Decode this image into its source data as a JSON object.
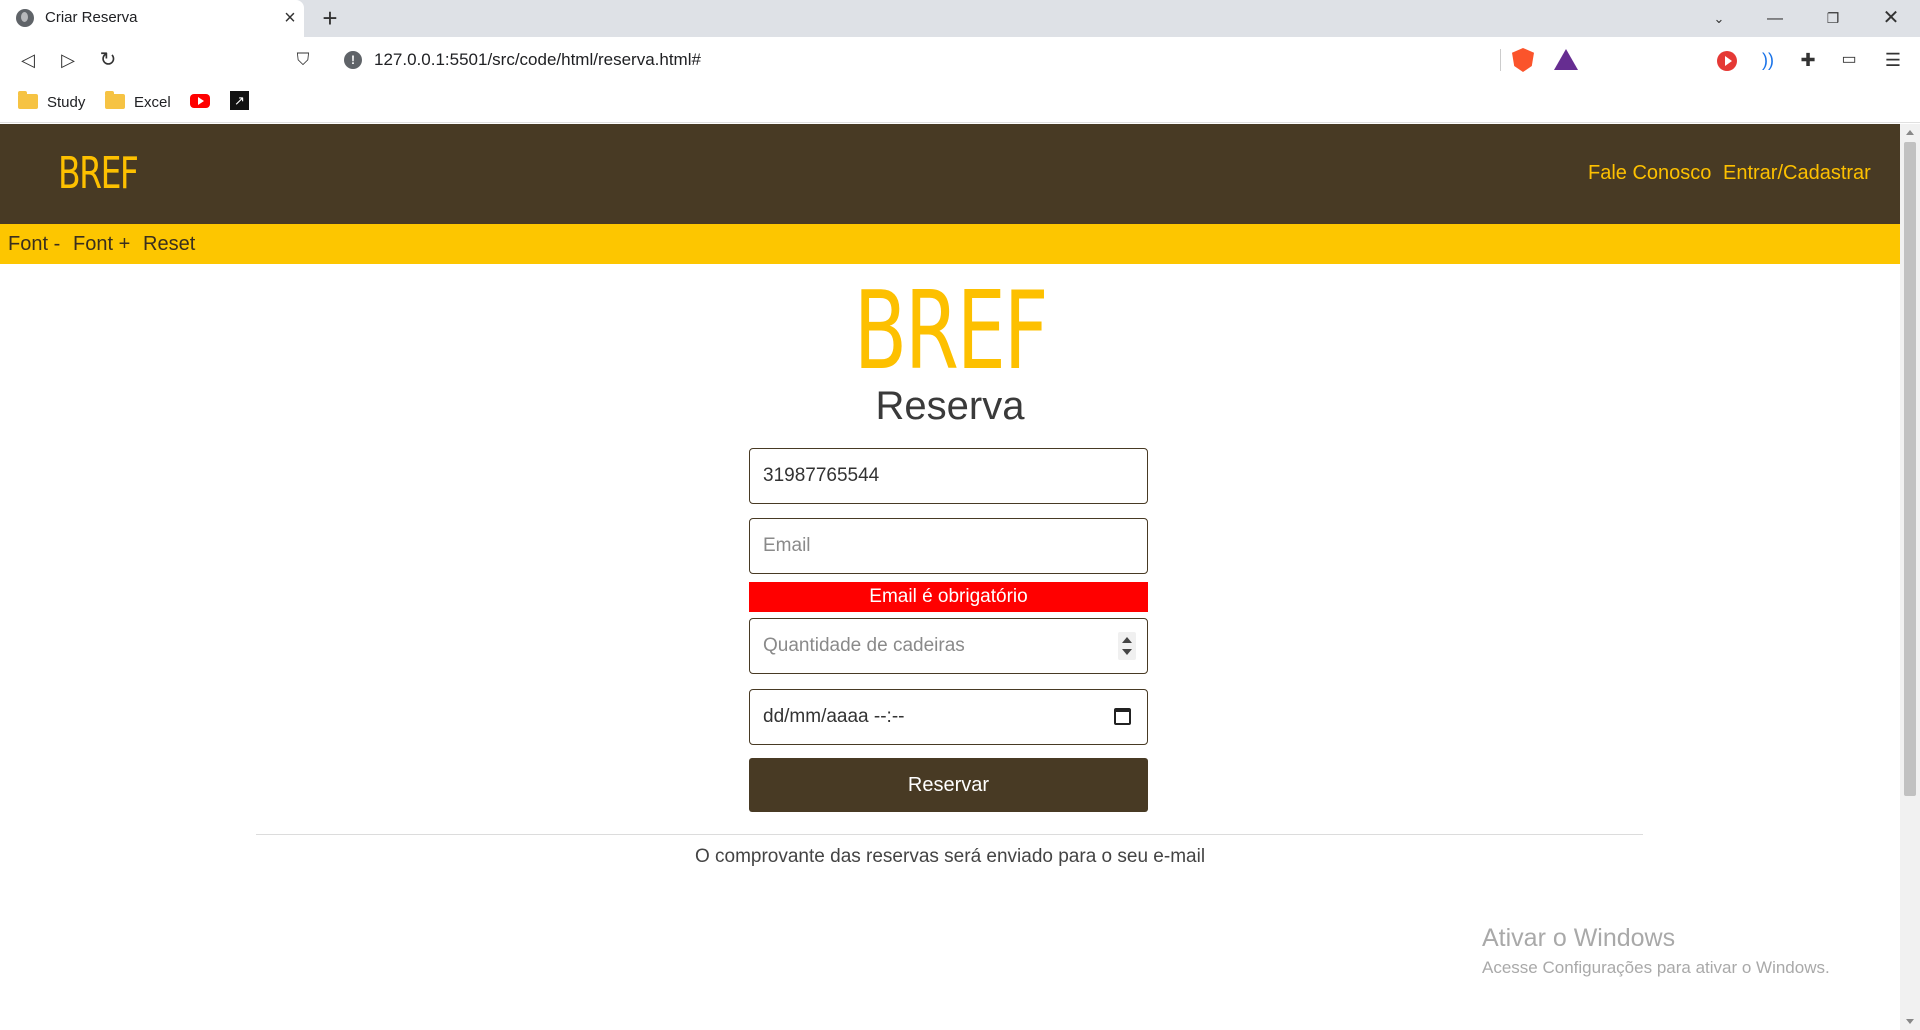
{
  "browser": {
    "tab_title": "Criar Reserva",
    "url": "127.0.0.1:5501/src/code/html/reserva.html#",
    "bookmarks": [
      "Study",
      "Excel"
    ]
  },
  "site": {
    "logo": "BREF",
    "nav": [
      "Fale Conosco",
      "Entrar/Cadastrar"
    ],
    "accessibility": [
      "Font -",
      "Font +",
      "Reset"
    ]
  },
  "form": {
    "logo": "BREF",
    "title": "Reserva",
    "phone_value": "31987765544",
    "email_placeholder": "Email",
    "email_error": "Email é obrigatório",
    "chairs_placeholder": "Quantidade de cadeiras",
    "datetime_placeholder": "dd/mm/aaaa --:--",
    "submit_label": "Reservar"
  },
  "footer_note": "O comprovante das reservas será enviado para o seu e-mail",
  "watermark": {
    "title": "Ativar o Windows",
    "subtitle": "Acesse Configurações para ativar o Windows."
  },
  "colors": {
    "header_bg": "#483a24",
    "accent_yellow": "#fdc000",
    "error_red": "#ff0000"
  }
}
